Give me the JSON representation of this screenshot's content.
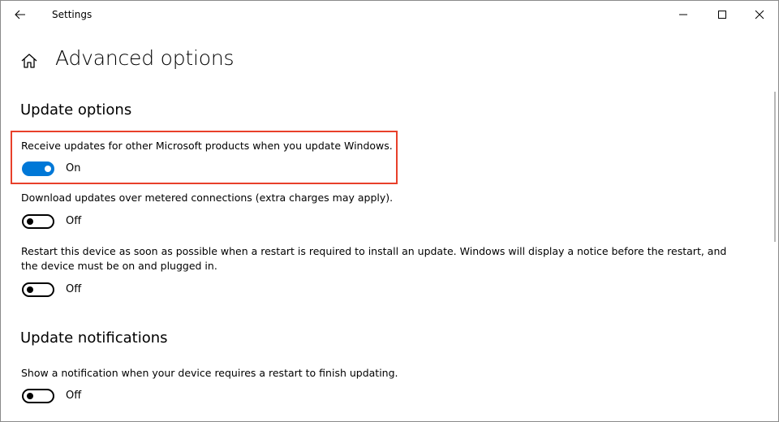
{
  "window": {
    "title": "Settings"
  },
  "header": {
    "title": "Advanced options"
  },
  "icons": {
    "back": "back-arrow-icon",
    "home": "home-icon",
    "minimize": "minimize-icon",
    "maximize": "maximize-icon",
    "close": "close-icon"
  },
  "colors": {
    "accent": "#0078d7",
    "highlight": "#e8402a"
  },
  "sections": {
    "update_options": {
      "heading": "Update options",
      "items": [
        {
          "description": "Receive updates for other Microsoft products when you update Windows.",
          "state": "On"
        },
        {
          "description": "Download updates over metered connections (extra charges may apply).",
          "state": "Off"
        },
        {
          "description": "Restart this device as soon as possible when a restart is required to install an update. Windows will display a notice before the restart, and the device must be on and plugged in.",
          "state": "Off"
        }
      ]
    },
    "update_notifications": {
      "heading": "Update notifications",
      "items": [
        {
          "description": "Show a notification when your device requires a restart to finish updating.",
          "state": "Off"
        }
      ]
    }
  }
}
